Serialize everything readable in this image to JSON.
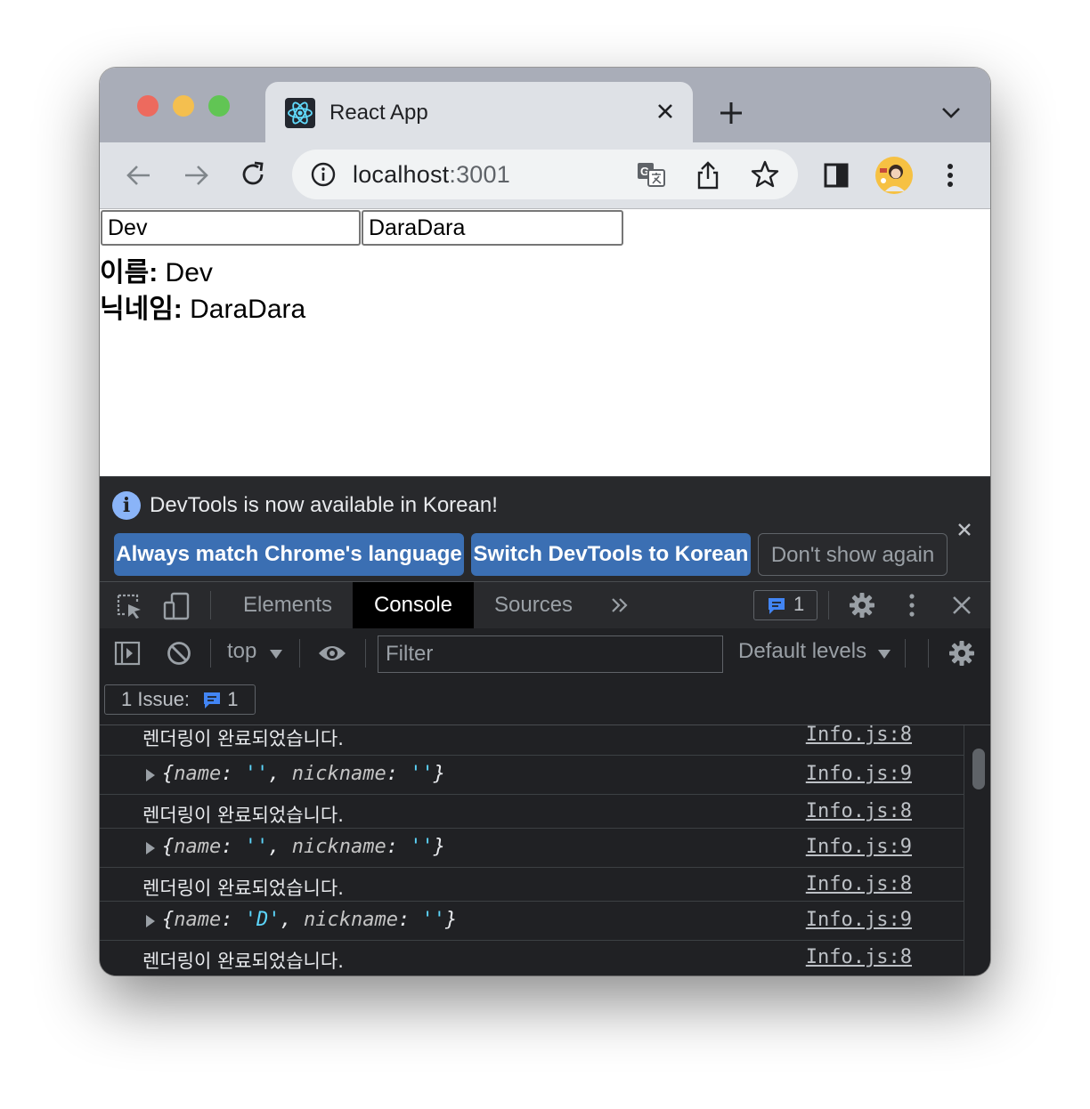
{
  "browser": {
    "tab_title": "React App",
    "url_host": "localhost",
    "url_port": ":3001"
  },
  "page": {
    "name_input_value": "Dev",
    "nickname_input_value": "DaraDara",
    "name_label": "이름:",
    "name_value": " Dev",
    "nickname_label": "닉네임:",
    "nickname_value": " DaraDara"
  },
  "devtools": {
    "infobar": {
      "message": "DevTools is now available in Korean!",
      "btn_match": "Always match Chrome's language",
      "btn_switch": "Switch DevTools to Korean",
      "btn_dont_show": "Don't show again"
    },
    "tabs": [
      "Elements",
      "Console",
      "Sources"
    ],
    "issues_badge_count": "1",
    "console_toolbar": {
      "context": "top",
      "filter_placeholder": "Filter",
      "levels": "Default levels"
    },
    "issues": {
      "label": "1 Issue:",
      "count": "1"
    },
    "log_rows": [
      {
        "type": "text",
        "text": "렌더링이 완료되었습니다.",
        "source": "Info.js:8"
      },
      {
        "type": "object",
        "name": "''",
        "nickname": "''",
        "source": "Info.js:9"
      },
      {
        "type": "text",
        "text": "렌더링이 완료되었습니다.",
        "source": "Info.js:8"
      },
      {
        "type": "object",
        "name": "''",
        "nickname": "''",
        "source": "Info.js:9"
      },
      {
        "type": "text",
        "text": "렌더링이 완료되었습니다.",
        "source": "Info.js:8"
      },
      {
        "type": "object",
        "name": "'D'",
        "nickname": "''",
        "source": "Info.js:9"
      },
      {
        "type": "text",
        "text": "렌더링이 완료되었습니다.",
        "source": "Info.js:8"
      }
    ],
    "object_keys": {
      "name": "name",
      "nickname": "nickname"
    }
  },
  "colors": {
    "accent_blue": "#3b6fb3",
    "string_cyan": "#5cd5fb",
    "traffic_red": "#ed6a5e",
    "traffic_yellow": "#f4bf4f",
    "traffic_green": "#61c554"
  }
}
